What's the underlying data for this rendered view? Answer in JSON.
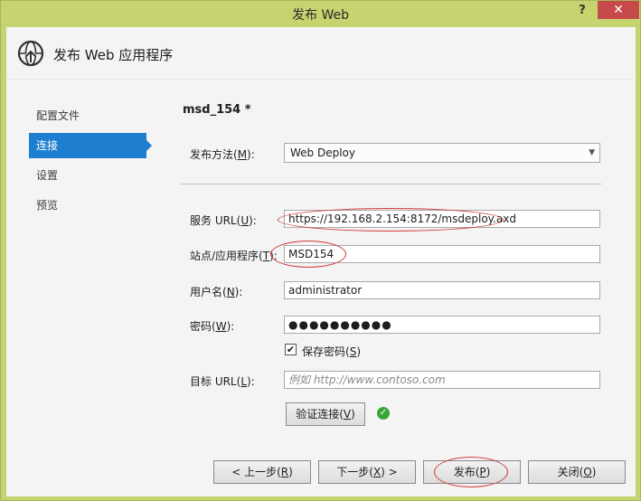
{
  "window": {
    "title": "发布 Web",
    "help": "?",
    "close": "✕"
  },
  "header": {
    "title": "发布 Web 应用程序",
    "icon": "globe-publish-icon"
  },
  "nav": {
    "items": [
      {
        "label": "配置文件",
        "active": false
      },
      {
        "label": "连接",
        "active": true
      },
      {
        "label": "设置",
        "active": false
      },
      {
        "label": "预览",
        "active": false
      }
    ]
  },
  "profile": {
    "name": "msd_154 *"
  },
  "form": {
    "method": {
      "label_prefix": "发布方法(",
      "label_key": "M",
      "label_suffix": "):",
      "value": "Web Deploy"
    },
    "service_url": {
      "label_prefix": "服务 URL(",
      "label_key": "U",
      "label_suffix": "):",
      "value": "https://192.168.2.154:8172/msdeploy.axd"
    },
    "site": {
      "label_prefix": "站点/应用程序(",
      "label_key": "T",
      "label_suffix": "):",
      "value": "MSD154"
    },
    "username": {
      "label_prefix": "用户名(",
      "label_key": "N",
      "label_suffix": "):",
      "value": "administrator"
    },
    "password": {
      "label_prefix": "密码(",
      "label_key": "W",
      "label_suffix": "):",
      "value": "●●●●●●●●●●"
    },
    "save_password": {
      "label_prefix": "保存密码(",
      "label_key": "S",
      "label_suffix": ")",
      "checked": true
    },
    "target_url": {
      "label_prefix": "目标 URL(",
      "label_key": "L",
      "label_suffix": "):",
      "placeholder": "例如 http://www.contoso.com"
    },
    "verify": {
      "label_prefix": "验证连接(",
      "label_key": "V",
      "label_suffix": ")"
    }
  },
  "footer": {
    "prev": {
      "label_prefix": "< 上一步(",
      "label_key": "R",
      "label_suffix": ")"
    },
    "next": {
      "label_prefix": "下一步(",
      "label_key": "X",
      "label_suffix": ") >"
    },
    "publish": {
      "label_prefix": "发布(",
      "label_key": "P",
      "label_suffix": ")"
    },
    "close": {
      "label_prefix": "关闭(",
      "label_key": "O",
      "label_suffix": ")"
    }
  },
  "colors": {
    "titlebar": "#c6d36f",
    "active_nav": "#1e7fd0",
    "annotation": "#d23a3a",
    "ok": "#3aa63a"
  }
}
